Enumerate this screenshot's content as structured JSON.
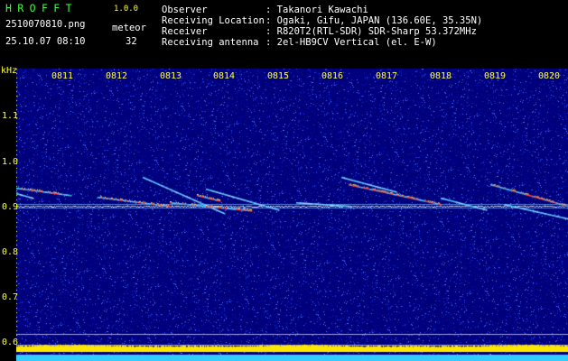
{
  "header": {
    "app_title": "HROFFT",
    "app_version": "1.0.0",
    "filename": "2510070810.png",
    "meteor_label": "meteor",
    "timestamp": "25.10.07 08:10",
    "meteor_count": "32",
    "info": [
      {
        "label": "Observer",
        "value": ": Takanori Kawachi"
      },
      {
        "label": "Receiving Location",
        "value": ": Ogaki, Gifu, JAPAN (136.60E, 35.35N)"
      },
      {
        "label": "Receiver",
        "value": ": R820T2(RTL-SDR) SDR-Sharp 53.372MHz"
      },
      {
        "label": "Receiving antenna",
        "value": ": 2el-HB9CV Vertical (el. E-W)"
      }
    ]
  },
  "axes": {
    "y_unit": "kHz",
    "y_ticks": [
      "1.1",
      "1.0",
      "0.9",
      "0.8",
      "0.7",
      "0.6"
    ],
    "x_ticks": [
      "0811",
      "0812",
      "0813",
      "0814",
      "0815",
      "0816",
      "0817",
      "0818",
      "0819",
      "0820"
    ]
  },
  "colors": {
    "background": "#000000",
    "plot": "#00007a",
    "title": "#3cff3c",
    "axis_text": "#ffff3c",
    "carrier": "#ffffff",
    "trace_warm": "#ff3c3c",
    "trace_cool": "#3cc8ff",
    "level_meter": "#ffe600",
    "level_base": "#33ccff"
  }
}
